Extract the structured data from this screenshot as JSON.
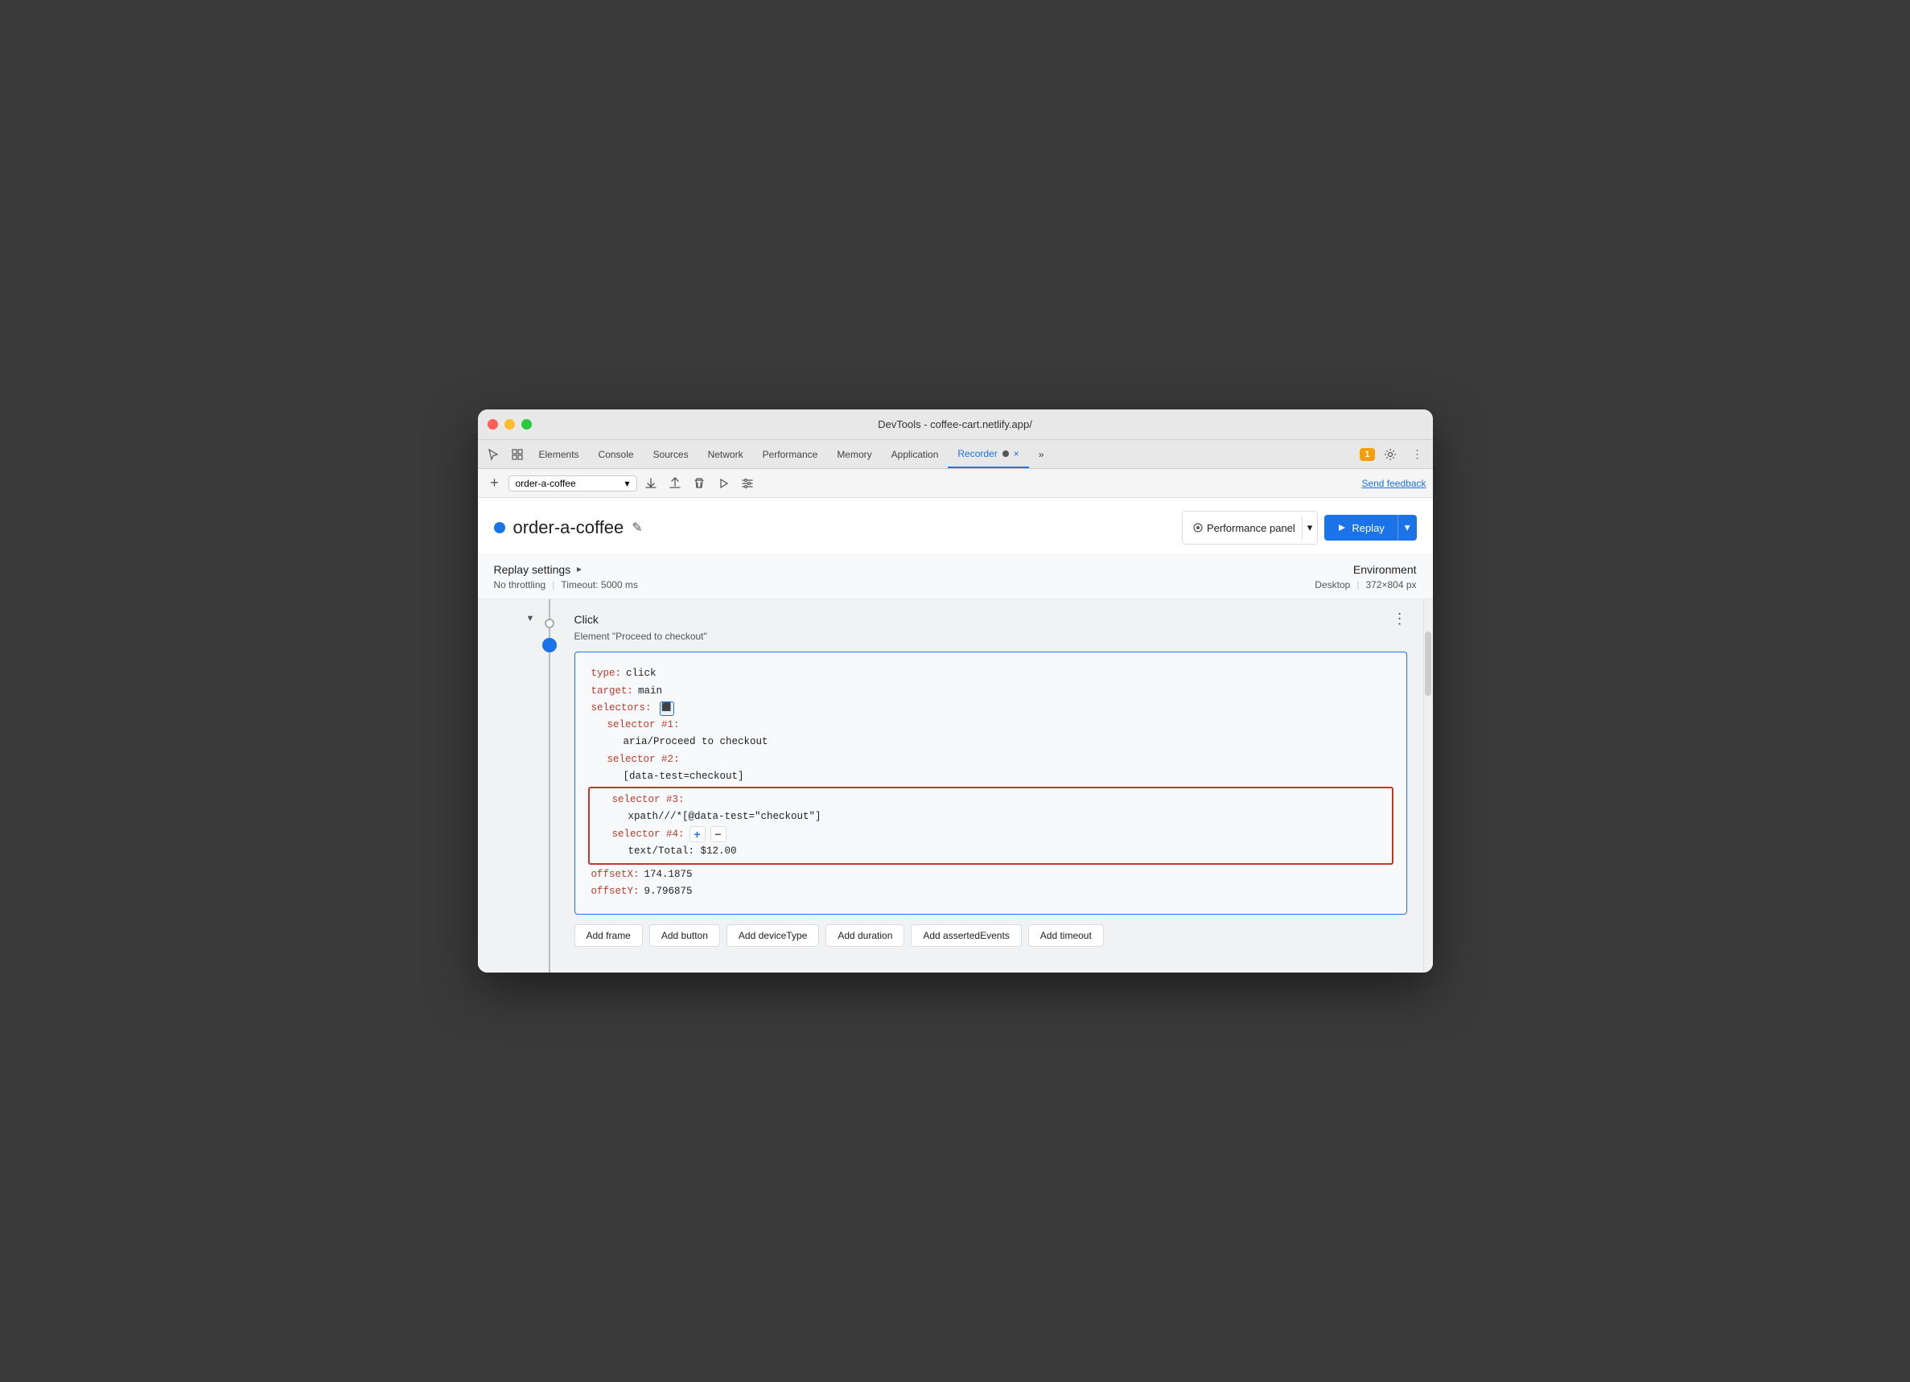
{
  "window": {
    "title": "DevTools - coffee-cart.netlify.app/"
  },
  "tabs": {
    "items": [
      "Elements",
      "Console",
      "Sources",
      "Network",
      "Performance",
      "Memory",
      "Application",
      "Recorder"
    ],
    "active": "Recorder",
    "recorder_close": "×",
    "more": "»"
  },
  "toolbar": {
    "new_btn": "+",
    "recording_name": "order-a-coffee",
    "send_feedback": "Send feedback"
  },
  "recording": {
    "title": "order-a-coffee",
    "perf_panel": "Performance panel",
    "replay": "Replay"
  },
  "settings": {
    "title": "Replay settings",
    "throttling": "No throttling",
    "timeout": "Timeout: 5000 ms",
    "env_label": "Environment",
    "env_value": "Desktop",
    "env_size": "372×804 px"
  },
  "step": {
    "type": "Click",
    "description": "Element \"Proceed to checkout\"",
    "code": {
      "type_key": "type:",
      "type_val": "click",
      "target_key": "target:",
      "target_val": "main",
      "selectors_key": "selectors:",
      "selector1_key": "selector #1:",
      "selector1_val": "aria/Proceed to checkout",
      "selector2_key": "selector #2:",
      "selector2_val": "[data-test=checkout]",
      "selector3_key": "selector #3:",
      "selector3_val": "xpath///*[@data-test=\"checkout\"]",
      "selector4_key": "selector #4:",
      "selector4_val": "text/Total: $12.00",
      "offsetX_key": "offsetX:",
      "offsetX_val": "174.1875",
      "offsetY_key": "offsetY:",
      "offsetY_val": "9.796875"
    }
  },
  "action_buttons": {
    "add_frame": "Add frame",
    "add_button": "Add button",
    "add_device_type": "Add deviceType",
    "add_duration": "Add duration",
    "add_asserted_events": "Add assertedEvents",
    "add_timeout": "Add timeout"
  },
  "icons": {
    "cursor": "⬆",
    "inspect": "⬚",
    "upload": "↑",
    "download": "↓",
    "delete": "🗑",
    "play": "▷",
    "replay_arc": "↺",
    "chevron_down": "▾",
    "edit": "✎",
    "play_filled": "▶",
    "perf_icon": "⊙",
    "triangle_right": "▶",
    "kebab": "⋮",
    "selector_icon": "⬛",
    "expand": "▼"
  },
  "notification": "1",
  "gear": "⚙",
  "more_vert": "⋮"
}
